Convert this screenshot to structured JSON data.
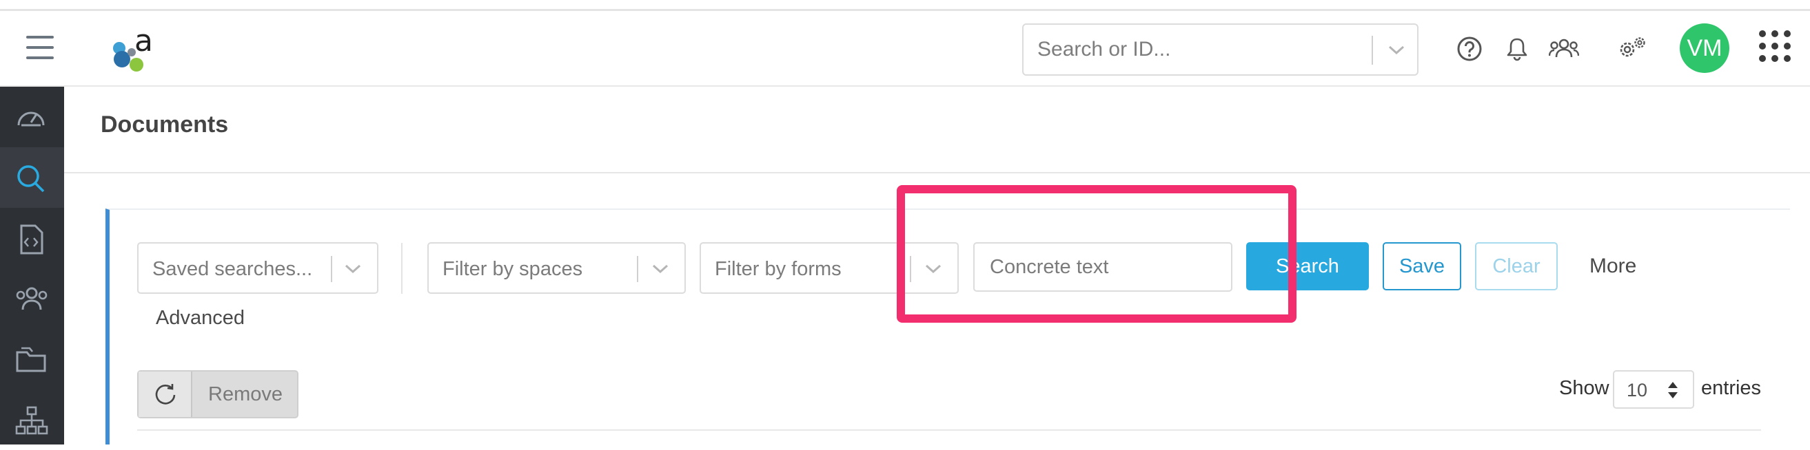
{
  "header": {
    "search_placeholder": "Search or ID...",
    "avatar_initials": "VM",
    "icons": [
      "hamburger-icon",
      "help-icon",
      "bell-icon",
      "users-icon",
      "settings-icon",
      "apps-grid-icon"
    ]
  },
  "sidebar": {
    "items": [
      {
        "name": "dashboard",
        "icon": "gauge-icon"
      },
      {
        "name": "search",
        "icon": "search-icon",
        "active": true
      },
      {
        "name": "documents",
        "icon": "code-file-icon"
      },
      {
        "name": "users",
        "icon": "users-icon"
      },
      {
        "name": "folders",
        "icon": "folders-icon"
      },
      {
        "name": "hierarchy",
        "icon": "sitemap-icon"
      }
    ]
  },
  "page": {
    "title": "Documents"
  },
  "filters": {
    "saved_searches": "Saved searches...",
    "spaces": "Filter by spaces",
    "forms": "Filter by forms",
    "text_placeholder": "Concrete text",
    "search_label": "Search",
    "save_label": "Save",
    "clear_label": "Clear",
    "more_label": "More",
    "advanced_label": "Advanced"
  },
  "table_controls": {
    "remove_label": "Remove",
    "show_label": "Show",
    "entries_value": "10",
    "entries_label": "entries"
  },
  "colors": {
    "accent": "#27a9df",
    "sidebar_bg": "#2d3035",
    "avatar": "#2ec56b",
    "highlight": "#f22e6e"
  }
}
